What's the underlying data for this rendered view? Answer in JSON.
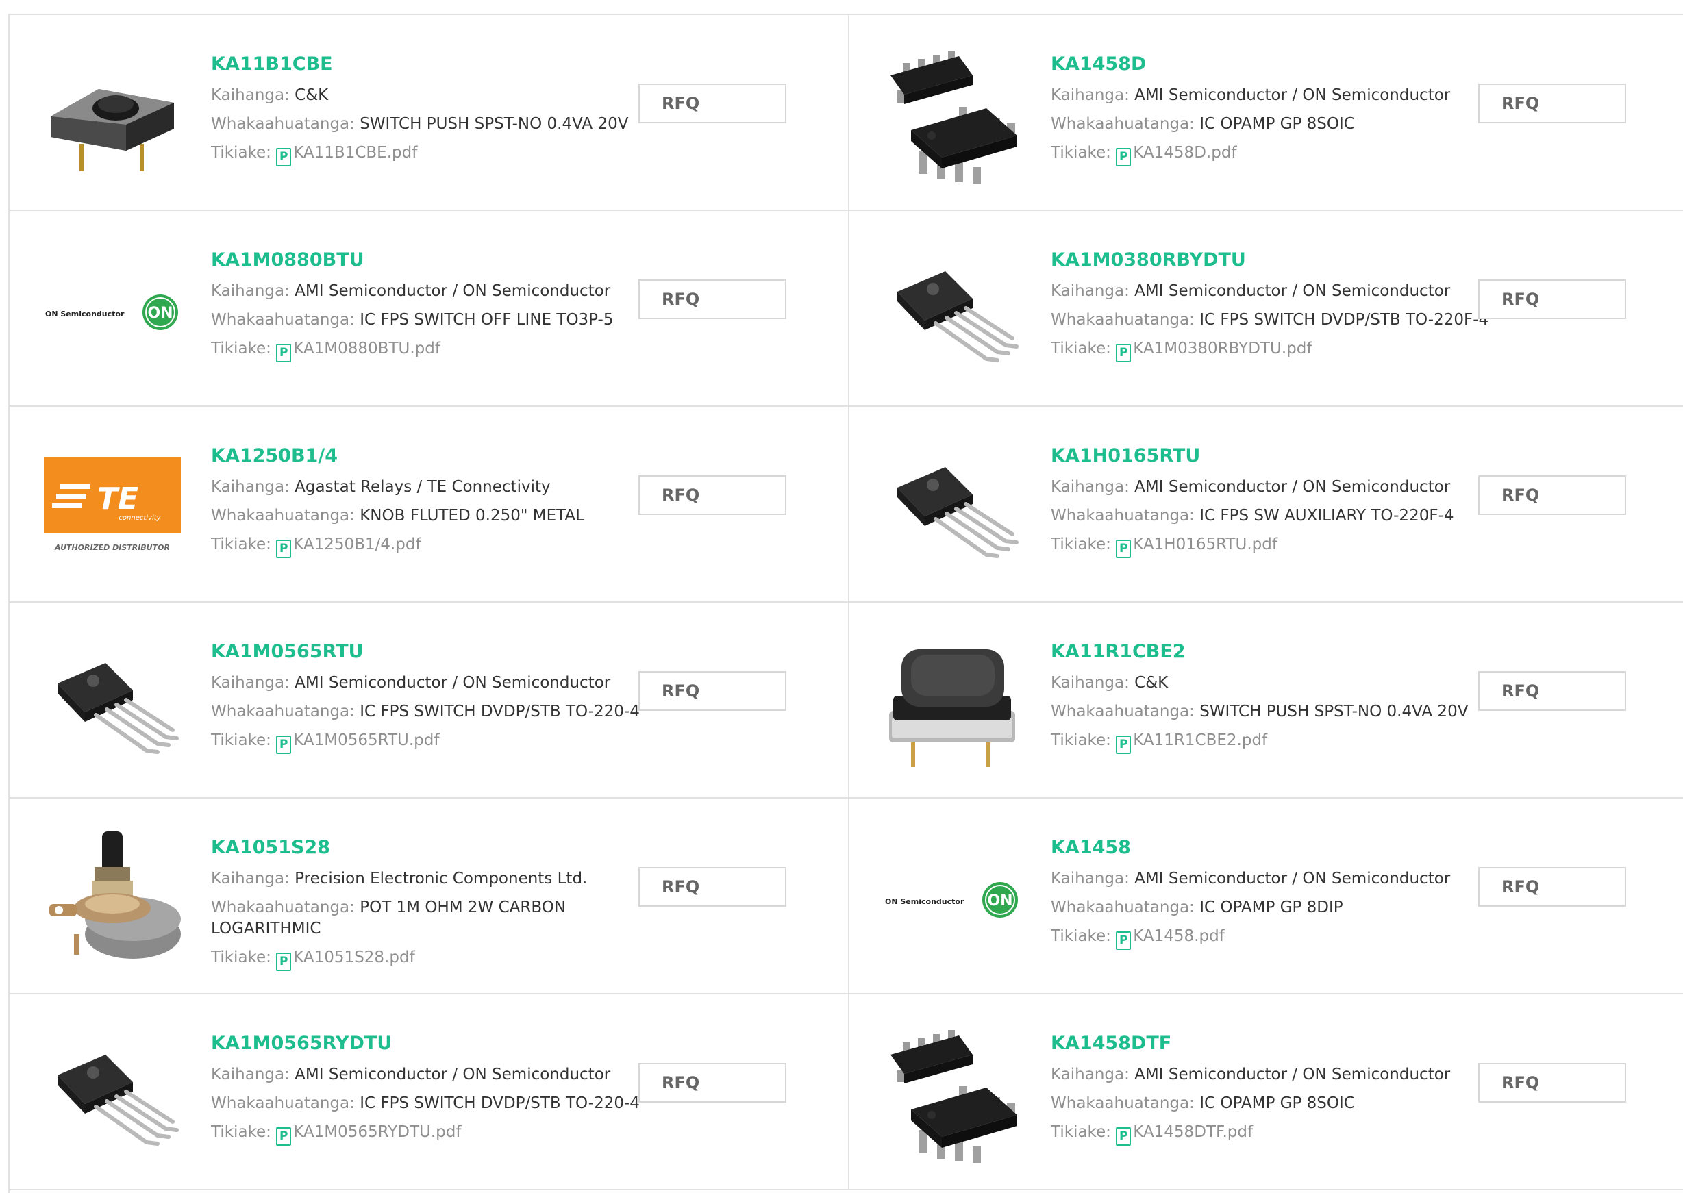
{
  "labels": {
    "manufacturer": "Kaihanga:",
    "description": "Whakaahuatanga:",
    "download": "Tikiake:",
    "rfq": "RFQ",
    "pdf_glyph": "P"
  },
  "brand_logos": {
    "on_semi_text": "ON Semiconductor",
    "on_semi_mark": "ON",
    "te_text": "TE",
    "te_sub": "connectivity",
    "te_tagline": "AUTHORIZED DISTRIBUTOR"
  },
  "colors": {
    "accent": "#1dbd8e",
    "te_orange": "#f28d1e",
    "on_green": "#2fa84f"
  },
  "products": [
    {
      "part": "KA11B1CBE",
      "manufacturer": "C&K",
      "description": "SWITCH PUSH SPST-NO 0.4VA 20V",
      "pdf": "KA11B1CBE.pdf",
      "image": "push-switch-image"
    },
    {
      "part": "KA1458D",
      "manufacturer": "AMI Semiconductor / ON Semiconductor",
      "description": "IC OPAMP GP 8SOIC",
      "pdf": "KA1458D.pdf",
      "image": "soic8-image"
    },
    {
      "part": "KA1M0880BTU",
      "manufacturer": "AMI Semiconductor / ON Semiconductor",
      "description": "IC FPS SWITCH OFF LINE TO3P-5",
      "pdf": "KA1M0880BTU.pdf",
      "image": "on-semiconductor-logo"
    },
    {
      "part": "KA1M0380RBYDTU",
      "manufacturer": "AMI Semiconductor / ON Semiconductor",
      "description": "IC FPS SWITCH DVDP/STB TO-220F-4",
      "pdf": "KA1M0380RBYDTU.pdf",
      "image": "to220-image"
    },
    {
      "part": "KA1250B1/4",
      "manufacturer": "Agastat Relays / TE Connectivity",
      "description": "KNOB FLUTED 0.250\" METAL",
      "pdf": "KA1250B1/4.pdf",
      "image": "te-connectivity-logo"
    },
    {
      "part": "KA1H0165RTU",
      "manufacturer": "AMI Semiconductor / ON Semiconductor",
      "description": "IC FPS SW AUXILIARY TO-220F-4",
      "pdf": "KA1H0165RTU.pdf",
      "image": "to220-image"
    },
    {
      "part": "KA1M0565RTU",
      "manufacturer": "AMI Semiconductor / ON Semiconductor",
      "description": "IC FPS SWITCH DVDP/STB TO-220-4",
      "pdf": "KA1M0565RTU.pdf",
      "image": "to220-image"
    },
    {
      "part": "KA11R1CBE2",
      "manufacturer": "C&K",
      "description": "SWITCH PUSH SPST-NO 0.4VA 20V",
      "pdf": "KA11R1CBE2.pdf",
      "image": "push-button-image"
    },
    {
      "part": "KA1051S28",
      "manufacturer": "Precision Electronic Components Ltd.",
      "description": "POT 1M OHM 2W CARBON LOGARITHMIC",
      "pdf": "KA1051S28.pdf",
      "image": "potentiometer-image"
    },
    {
      "part": "KA1458",
      "manufacturer": "AMI Semiconductor / ON Semiconductor",
      "description": "IC OPAMP GP 8DIP",
      "pdf": "KA1458.pdf",
      "image": "on-semiconductor-logo"
    },
    {
      "part": "KA1M0565RYDTU",
      "manufacturer": "AMI Semiconductor / ON Semiconductor",
      "description": "IC FPS SWITCH DVDP/STB TO-220-4",
      "pdf": "KA1M0565RYDTU.pdf",
      "image": "to220-image"
    },
    {
      "part": "KA1458DTF",
      "manufacturer": "AMI Semiconductor / ON Semiconductor",
      "description": "IC OPAMP GP 8SOIC",
      "pdf": "KA1458DTF.pdf",
      "image": "soic8-image"
    }
  ]
}
